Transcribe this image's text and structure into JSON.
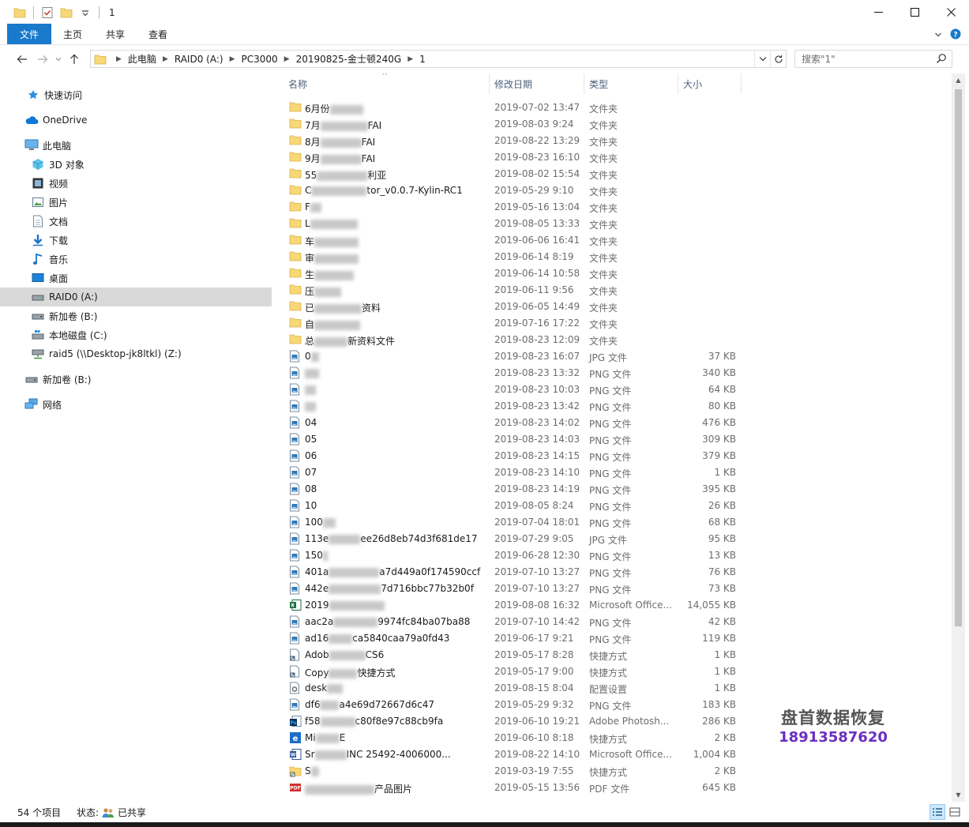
{
  "window": {
    "title": "1",
    "controls": {
      "minimize": "─",
      "maximize": "☐",
      "close": "✕"
    }
  },
  "ribbon": {
    "tabs": [
      "文件",
      "主页",
      "共享",
      "查看"
    ],
    "accent": "#1979ca"
  },
  "address": {
    "crumbs": [
      "此电脑",
      "RAID0 (A:)",
      "PC3000",
      "20190825-金士顿240G",
      "1"
    ]
  },
  "search": {
    "placeholder": "搜索\"1\""
  },
  "sidebar": {
    "items": [
      {
        "label": "快速访问",
        "icon": "star-icon"
      },
      {
        "label": "OneDrive",
        "icon": "cloud-icon"
      },
      {
        "label": "此电脑",
        "icon": "computer-icon"
      },
      {
        "label": "3D 对象",
        "icon": "cube-icon"
      },
      {
        "label": "视频",
        "icon": "video-icon"
      },
      {
        "label": "图片",
        "icon": "picture-icon"
      },
      {
        "label": "文档",
        "icon": "document-icon"
      },
      {
        "label": "下载",
        "icon": "download-icon"
      },
      {
        "label": "音乐",
        "icon": "music-icon"
      },
      {
        "label": "桌面",
        "icon": "desktop-icon"
      },
      {
        "label": "RAID0 (A:)",
        "icon": "drive-icon"
      },
      {
        "label": "新加卷 (B:)",
        "icon": "drive-icon"
      },
      {
        "label": "本地磁盘 (C:)",
        "icon": "windows-drive-icon"
      },
      {
        "label": "raid5 (\\\\Desktop-jk8ltkl) (Z:)",
        "icon": "network-drive-icon"
      },
      {
        "label": "新加卷 (B:)",
        "icon": "drive-icon"
      },
      {
        "label": "网络",
        "icon": "network-icon"
      }
    ]
  },
  "columns": {
    "name": "名称",
    "date": "修改日期",
    "type": "类型",
    "size": "大小"
  },
  "files": [
    {
      "name_a": "6月份",
      "name_b": "",
      "date": "2019-07-02 13:47",
      "type": "文件夹",
      "size": "",
      "icon": "folder"
    },
    {
      "name_a": "7月",
      "name_b": "FAI",
      "date": "2019-08-03 9:24",
      "type": "文件夹",
      "size": "",
      "icon": "folder"
    },
    {
      "name_a": "8月",
      "name_b": "FAI",
      "date": "2019-08-22 13:29",
      "type": "文件夹",
      "size": "",
      "icon": "folder"
    },
    {
      "name_a": "9月",
      "name_b": "FAI",
      "date": "2019-08-23 16:10",
      "type": "文件夹",
      "size": "",
      "icon": "folder"
    },
    {
      "name_a": "55",
      "name_b": "利亚",
      "date": "2019-08-02 15:54",
      "type": "文件夹",
      "size": "",
      "icon": "folder"
    },
    {
      "name_a": "C",
      "name_b": "tor_v0.0.7-Kylin-RC1",
      "date": "2019-05-29 9:10",
      "type": "文件夹",
      "size": "",
      "icon": "folder"
    },
    {
      "name_a": "F",
      "name_b": "",
      "date": "2019-05-16 13:04",
      "type": "文件夹",
      "size": "",
      "icon": "folder"
    },
    {
      "name_a": "L",
      "name_b": "",
      "date": "2019-08-05 13:33",
      "type": "文件夹",
      "size": "",
      "icon": "folder"
    },
    {
      "name_a": "车",
      "name_b": "",
      "date": "2019-06-06 16:41",
      "type": "文件夹",
      "size": "",
      "icon": "folder"
    },
    {
      "name_a": "审",
      "name_b": "",
      "date": "2019-06-14 8:19",
      "type": "文件夹",
      "size": "",
      "icon": "folder"
    },
    {
      "name_a": "生",
      "name_b": "",
      "date": "2019-06-14 10:58",
      "type": "文件夹",
      "size": "",
      "icon": "folder"
    },
    {
      "name_a": "压",
      "name_b": "",
      "date": "2019-06-11 9:56",
      "type": "文件夹",
      "size": "",
      "icon": "folder"
    },
    {
      "name_a": "已",
      "name_b": "资料",
      "date": "2019-06-05 14:49",
      "type": "文件夹",
      "size": "",
      "icon": "folder"
    },
    {
      "name_a": "自",
      "name_b": "",
      "date": "2019-07-16 17:22",
      "type": "文件夹",
      "size": "",
      "icon": "folder"
    },
    {
      "name_a": "总",
      "name_b": "新资料文件",
      "date": "2019-08-23 12:09",
      "type": "文件夹",
      "size": "",
      "icon": "folder"
    },
    {
      "name_a": "0",
      "name_b": "",
      "date": "2019-08-23 16:07",
      "type": "JPG 文件",
      "size": "37 KB",
      "icon": "image"
    },
    {
      "name_a": "",
      "name_b": "",
      "date": "2019-08-23 13:32",
      "type": "PNG 文件",
      "size": "340 KB",
      "icon": "image"
    },
    {
      "name_a": "",
      "name_b": "",
      "date": "2019-08-23 10:03",
      "type": "PNG 文件",
      "size": "64 KB",
      "icon": "image"
    },
    {
      "name_a": "",
      "name_b": "",
      "date": "2019-08-23 13:42",
      "type": "PNG 文件",
      "size": "80 KB",
      "icon": "image"
    },
    {
      "name_a": "04",
      "name_b": "",
      "date": "2019-08-23 14:02",
      "type": "PNG 文件",
      "size": "476 KB",
      "icon": "image"
    },
    {
      "name_a": "05",
      "name_b": "",
      "date": "2019-08-23 14:03",
      "type": "PNG 文件",
      "size": "309 KB",
      "icon": "image"
    },
    {
      "name_a": "06",
      "name_b": "",
      "date": "2019-08-23 14:15",
      "type": "PNG 文件",
      "size": "379 KB",
      "icon": "image"
    },
    {
      "name_a": "07",
      "name_b": "",
      "date": "2019-08-23 14:10",
      "type": "PNG 文件",
      "size": "1 KB",
      "icon": "image"
    },
    {
      "name_a": "08",
      "name_b": "",
      "date": "2019-08-23 14:19",
      "type": "PNG 文件",
      "size": "395 KB",
      "icon": "image"
    },
    {
      "name_a": "10",
      "name_b": "",
      "date": "2019-08-05 8:24",
      "type": "PNG 文件",
      "size": "26 KB",
      "icon": "image"
    },
    {
      "name_a": "100",
      "name_b": "",
      "date": "2019-07-04 18:01",
      "type": "PNG 文件",
      "size": "68 KB",
      "icon": "image"
    },
    {
      "name_a": "113e",
      "name_b": "ee26d8eb74d3f681de17",
      "date": "2019-07-29 9:05",
      "type": "JPG 文件",
      "size": "95 KB",
      "icon": "image"
    },
    {
      "name_a": "150",
      "name_b": "",
      "date": "2019-06-28 12:30",
      "type": "PNG 文件",
      "size": "13 KB",
      "icon": "image"
    },
    {
      "name_a": "401a",
      "name_b": "a7d449a0f174590ccf",
      "date": "2019-07-10 13:27",
      "type": "PNG 文件",
      "size": "76 KB",
      "icon": "image"
    },
    {
      "name_a": "442e",
      "name_b": "7d716bbc77b32b0f",
      "date": "2019-07-10 13:27",
      "type": "PNG 文件",
      "size": "73 KB",
      "icon": "image"
    },
    {
      "name_a": "2019",
      "name_b": "",
      "date": "2019-08-08 16:32",
      "type": "Microsoft Office...",
      "size": "14,055 KB",
      "icon": "excel"
    },
    {
      "name_a": "aac2a",
      "name_b": "9974fc84ba07ba88",
      "date": "2019-07-10 14:42",
      "type": "PNG 文件",
      "size": "42 KB",
      "icon": "image"
    },
    {
      "name_a": "ad16",
      "name_b": "ca5840caa79a0fd43",
      "date": "2019-06-17 9:21",
      "type": "PNG 文件",
      "size": "119 KB",
      "icon": "image"
    },
    {
      "name_a": "Adob",
      "name_b": "CS6",
      "date": "2019-05-17 8:28",
      "type": "快捷方式",
      "size": "1 KB",
      "icon": "shortcut"
    },
    {
      "name_a": "Copy",
      "name_b": "快捷方式",
      "date": "2019-05-17 9:00",
      "type": "快捷方式",
      "size": "1 KB",
      "icon": "shortcut"
    },
    {
      "name_a": "desk",
      "name_b": "",
      "date": "2019-08-15 8:04",
      "type": "配置设置",
      "size": "1 KB",
      "icon": "settings"
    },
    {
      "name_a": "df6",
      "name_b": "a4e69d72667d6c47",
      "date": "2019-05-29 9:32",
      "type": "PNG 文件",
      "size": "183 KB",
      "icon": "image"
    },
    {
      "name_a": "f58",
      "name_b": "c80f8e97c88cb9fa",
      "date": "2019-06-10 19:21",
      "type": "Adobe Photosh...",
      "size": "286 KB",
      "icon": "photoshop"
    },
    {
      "name_a": "Mi",
      "name_b": "E",
      "date": "2019-06-10 8:18",
      "type": "快捷方式",
      "size": "2 KB",
      "icon": "ie"
    },
    {
      "name_a": "Sr",
      "name_b": "INC 25492-4006000...",
      "date": "2019-08-22 14:10",
      "type": "Microsoft Office...",
      "size": "1,004 KB",
      "icon": "word"
    },
    {
      "name_a": "S",
      "name_b": "",
      "date": "2019-03-19 7:55",
      "type": "快捷方式",
      "size": "2 KB",
      "icon": "shortcut-folder"
    },
    {
      "name_a": "",
      "name_b": "产品图片",
      "date": "2019-05-15 13:56",
      "type": "PDF 文件",
      "size": "645 KB",
      "icon": "pdf"
    }
  ],
  "status": {
    "count": "54 个项目",
    "state_label": "状态:",
    "state_value": "已共享"
  },
  "watermark": {
    "line1": "盘首数据恢复",
    "line2": "18913587620"
  }
}
